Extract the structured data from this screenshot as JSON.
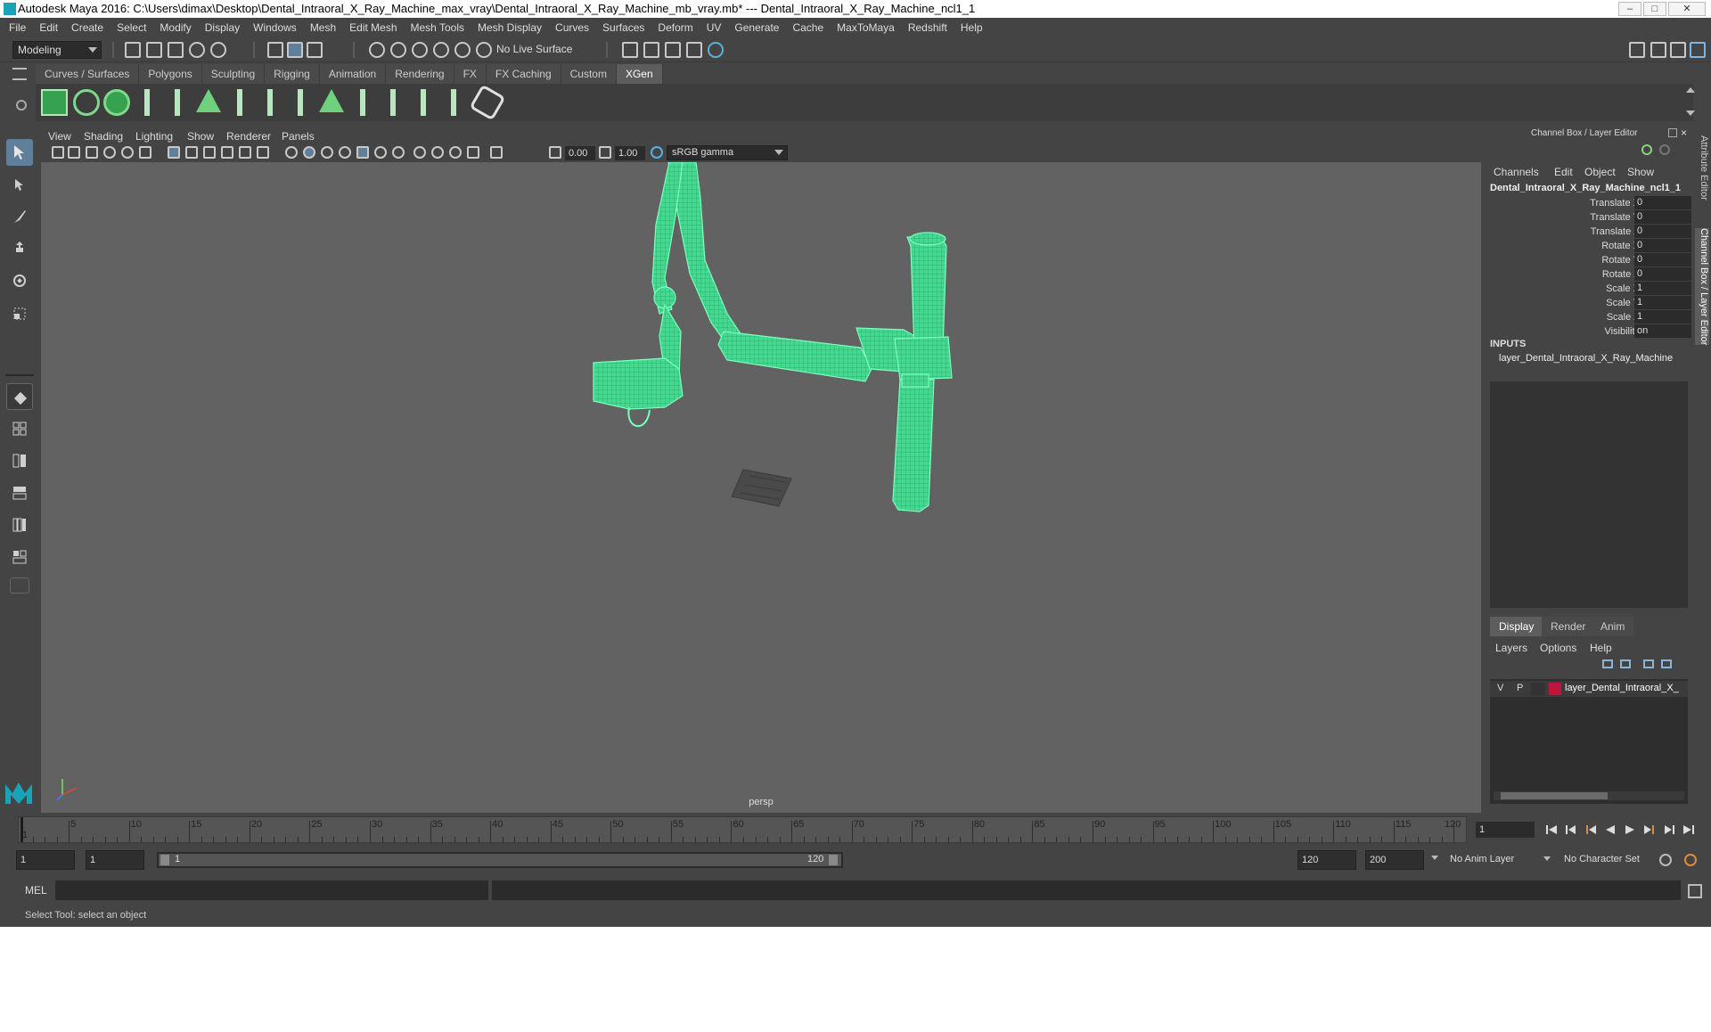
{
  "window": {
    "title": "Autodesk Maya 2016: C:\\Users\\dimax\\Desktop\\Dental_Intraoral_X_Ray_Machine_max_vray\\Dental_Intraoral_X_Ray_Machine_mb_vray.mb*   ---   Dental_Intraoral_X_Ray_Machine_ncl1_1",
    "minimize": "–",
    "maximize": "□",
    "close": "✕"
  },
  "menubar": [
    "File",
    "Edit",
    "Create",
    "Select",
    "Modify",
    "Display",
    "Windows",
    "Mesh",
    "Edit Mesh",
    "Mesh Tools",
    "Mesh Display",
    "Curves",
    "Surfaces",
    "Deform",
    "UV",
    "Generate",
    "Cache",
    "MaxToMaya",
    "Redshift",
    "Help"
  ],
  "statusline": {
    "mode": "Modeling",
    "live_surface": "No Live Surface"
  },
  "shelf": {
    "tabs": [
      "Curves / Surfaces",
      "Polygons",
      "Sculpting",
      "Rigging",
      "Animation",
      "Rendering",
      "FX",
      "FX Caching",
      "Custom",
      "XGen"
    ],
    "active_tab": "XGen"
  },
  "viewport": {
    "menu": [
      "View",
      "Shading",
      "Lighting",
      "Show",
      "Renderer",
      "Panels"
    ],
    "exposure": "0.00",
    "gamma": "1.00",
    "color_space": "sRGB gamma",
    "camera_label": "persp",
    "wire_color": "#4fffa6"
  },
  "channelbox": {
    "header": "Channel Box / Layer Editor",
    "menu": [
      "Channels",
      "Edit",
      "Object",
      "Show"
    ],
    "object_name": "Dental_Intraoral_X_Ray_Machine_ncl1_1",
    "attributes": [
      {
        "name": "Translate X",
        "value": "0"
      },
      {
        "name": "Translate Y",
        "value": "0"
      },
      {
        "name": "Translate Z",
        "value": "0"
      },
      {
        "name": "Rotate X",
        "value": "0"
      },
      {
        "name": "Rotate Y",
        "value": "0"
      },
      {
        "name": "Rotate Z",
        "value": "0"
      },
      {
        "name": "Scale X",
        "value": "1"
      },
      {
        "name": "Scale Y",
        "value": "1"
      },
      {
        "name": "Scale Z",
        "value": "1"
      },
      {
        "name": "Visibility",
        "value": "on"
      }
    ],
    "inputs_label": "INPUTS",
    "input_node": "layer_Dental_Intraoral_X_Ray_Machine",
    "layer_tabs": [
      "Display",
      "Render",
      "Anim"
    ],
    "active_layer_tab": "Display",
    "layer_menu": [
      "Layers",
      "Options",
      "Help"
    ],
    "layer": {
      "v": "V",
      "p": "P",
      "name": "layer_Dental_Intraoral_X_",
      "color": "#c0143c"
    },
    "side_tabs": [
      "Attribute Editor",
      "Channel Box / Layer Editor"
    ]
  },
  "timeslider": {
    "ticks": [
      "1",
      "5",
      "10",
      "15",
      "20",
      "25",
      "30",
      "35",
      "40",
      "45",
      "50",
      "55",
      "60",
      "65",
      "70",
      "75",
      "80",
      "85",
      "90",
      "95",
      "100",
      "105",
      "110",
      "115",
      "120"
    ],
    "current_frame": "1"
  },
  "range": {
    "start": "1",
    "anim_start": "1",
    "range_start_label": "1",
    "range_end_label": "120",
    "end": "120",
    "anim_end": "200",
    "anim_layer": "No Anim Layer",
    "character_set": "No Character Set"
  },
  "cmdline": {
    "label": "MEL"
  },
  "helpline": {
    "text": "Select Tool: select an object"
  }
}
